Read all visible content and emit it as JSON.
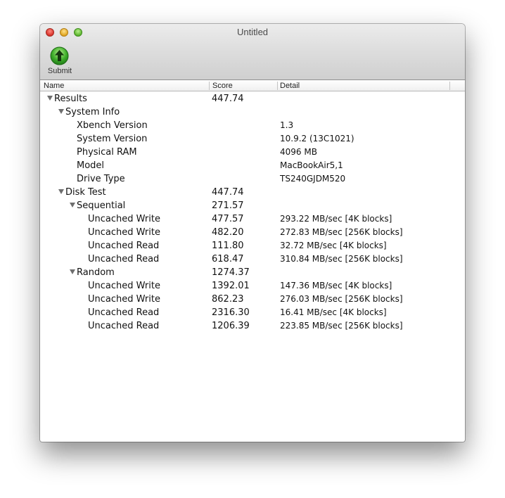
{
  "window": {
    "title": "Untitled"
  },
  "toolbar": {
    "submit_label": "Submit",
    "submit_icon": "upload-arrow-icon",
    "accent_color": "#2e9a2e"
  },
  "table": {
    "columns": [
      "Name",
      "Score",
      "Detail"
    ],
    "rows": [
      {
        "name": "Results",
        "score": "447.74",
        "detail": "",
        "level": 0,
        "disclosure": true
      },
      {
        "name": "System Info",
        "score": "",
        "detail": "",
        "level": 1,
        "disclosure": true
      },
      {
        "name": "Xbench Version",
        "score": "",
        "detail": "1.3",
        "level": 2,
        "disclosure": false
      },
      {
        "name": "System Version",
        "score": "",
        "detail": "10.9.2 (13C1021)",
        "level": 2,
        "disclosure": false
      },
      {
        "name": "Physical RAM",
        "score": "",
        "detail": "4096 MB",
        "level": 2,
        "disclosure": false
      },
      {
        "name": "Model",
        "score": "",
        "detail": "MacBookAir5,1",
        "level": 2,
        "disclosure": false
      },
      {
        "name": "Drive Type",
        "score": "",
        "detail": "TS240GJDM520",
        "level": 2,
        "disclosure": false
      },
      {
        "name": "Disk Test",
        "score": "447.74",
        "detail": "",
        "level": 1,
        "disclosure": true
      },
      {
        "name": "Sequential",
        "score": "271.57",
        "detail": "",
        "level": 2,
        "disclosure": true
      },
      {
        "name": "Uncached Write",
        "score": "477.57",
        "detail": "293.22 MB/sec [4K blocks]",
        "level": 3,
        "disclosure": false
      },
      {
        "name": "Uncached Write",
        "score": "482.20",
        "detail": "272.83 MB/sec [256K blocks]",
        "level": 3,
        "disclosure": false
      },
      {
        "name": "Uncached Read",
        "score": "111.80",
        "detail": "32.72 MB/sec [4K blocks]",
        "level": 3,
        "disclosure": false
      },
      {
        "name": "Uncached Read",
        "score": "618.47",
        "detail": "310.84 MB/sec [256K blocks]",
        "level": 3,
        "disclosure": false
      },
      {
        "name": "Random",
        "score": "1274.37",
        "detail": "",
        "level": 2,
        "disclosure": true
      },
      {
        "name": "Uncached Write",
        "score": "1392.01",
        "detail": "147.36 MB/sec [4K blocks]",
        "level": 3,
        "disclosure": false
      },
      {
        "name": "Uncached Write",
        "score": "862.23",
        "detail": "276.03 MB/sec [256K blocks]",
        "level": 3,
        "disclosure": false
      },
      {
        "name": "Uncached Read",
        "score": "2316.30",
        "detail": "16.41 MB/sec [4K blocks]",
        "level": 3,
        "disclosure": false
      },
      {
        "name": "Uncached Read",
        "score": "1206.39",
        "detail": "223.85 MB/sec [256K blocks]",
        "level": 3,
        "disclosure": false
      }
    ]
  }
}
